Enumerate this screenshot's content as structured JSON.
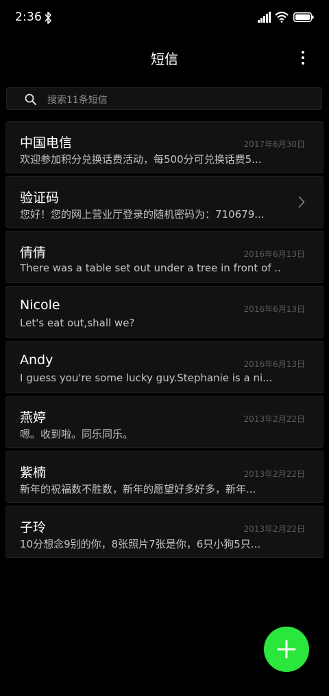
{
  "status_bar": {
    "time": "2:36",
    "icons": [
      "bluetooth-icon",
      "signal-icon",
      "wifi-icon",
      "battery-icon"
    ]
  },
  "header": {
    "title": "短信",
    "menu_icon": "more-vertical-icon"
  },
  "search": {
    "placeholder": "搜索11条短信",
    "icon": "search-icon"
  },
  "conversations": [
    {
      "name": "中国电信",
      "date": "2017年6月30日",
      "preview": "欢迎参加积分兑换话费活动，每500分可兑换话费5..."
    },
    {
      "name": "验证码",
      "date": "",
      "preview": "您好！您的网上营业厅登录的随机密码为：710679...",
      "icon": "chevron-right-icon"
    },
    {
      "name": "倩倩",
      "date": "2016年6月13日",
      "preview": "There was a table set out under a tree in front of ..."
    },
    {
      "name": "Nicole",
      "date": "2016年6月13日",
      "preview": "Let's eat out,shall we?"
    },
    {
      "name": "Andy",
      "date": "2016年6月13日",
      "preview": "I guess you're some lucky guy.Stephanie is a ni..."
    },
    {
      "name": "燕婷",
      "date": "2013年2月22日",
      "preview": "嗯。收到啦。同乐同乐。"
    },
    {
      "name": "紫楠",
      "date": "2013年2月22日",
      "preview": "新年的祝福数不胜数，新年的愿望好多好多，新年..."
    },
    {
      "name": "子玲",
      "date": "2013年2月22日",
      "preview": "10分想念9别的你，8张照片7张是你，6只小狗5只..."
    }
  ],
  "fab": {
    "icon": "plus-icon"
  },
  "colors": {
    "background": "#000000",
    "card": "#121212",
    "accent": "#2be63c"
  }
}
